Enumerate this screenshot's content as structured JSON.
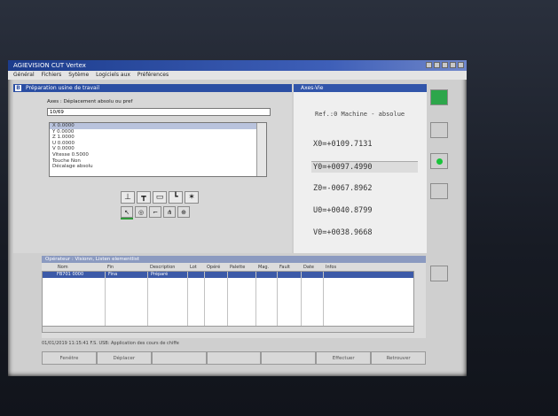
{
  "window": {
    "title": "AGIEVISION CUT Vertex"
  },
  "menu": [
    "Général",
    "Fichiers",
    "Sytème",
    "Logiciels aux",
    "Préférences"
  ],
  "left_panel": {
    "title": "Préparation usine de travail",
    "badge": "B",
    "field_label": "Axes : Déplacement absolu ou pref",
    "field_value": "10/69",
    "list_items": [
      "X  0.0000",
      "Y  0.0000",
      "Z  1.0000",
      "U  0.0000",
      "V  0.0000",
      "Vitesse  0.5000",
      "Touche  Non",
      "Décalage  absolu"
    ],
    "selected_index": 0
  },
  "right_panel": {
    "title": "Axes-Vie",
    "ref_text": "Ref.:0 Machine - absolue",
    "axes": [
      {
        "label": "X0=+0109.7131"
      },
      {
        "label": "Y0=+0097.4990"
      },
      {
        "label": "Z0=-0067.8962"
      },
      {
        "label": "U0=+0040.8799"
      },
      {
        "label": "V0=+0038.9668"
      }
    ]
  },
  "bottom_panel": {
    "title": "Opérateur : Visionn, Listen elementlist",
    "columns": [
      "Nom",
      "Fin",
      "Description",
      "Lot",
      "Opéré",
      "Palette",
      "Mag.",
      "Fault",
      "Date",
      "Infos"
    ],
    "row": {
      "name": "FB701 0000",
      "fin": "Fina",
      "desc": "Préparé"
    }
  },
  "status_text": "01/01/2019 11:15:41 F.S. USB: Application des cours de chiffe",
  "softkeys": [
    "Fenêtre",
    "Déplacer",
    "",
    "",
    "",
    "Effectuer",
    "Retrouver"
  ],
  "tool_icons": [
    "probe-icon",
    "t-slot-icon",
    "square-icon",
    "corner-icon",
    "star-icon",
    "probe-cursor-icon",
    "circle-probe-icon",
    "edge-icon",
    "fan-icon",
    "tool-set-icon"
  ]
}
